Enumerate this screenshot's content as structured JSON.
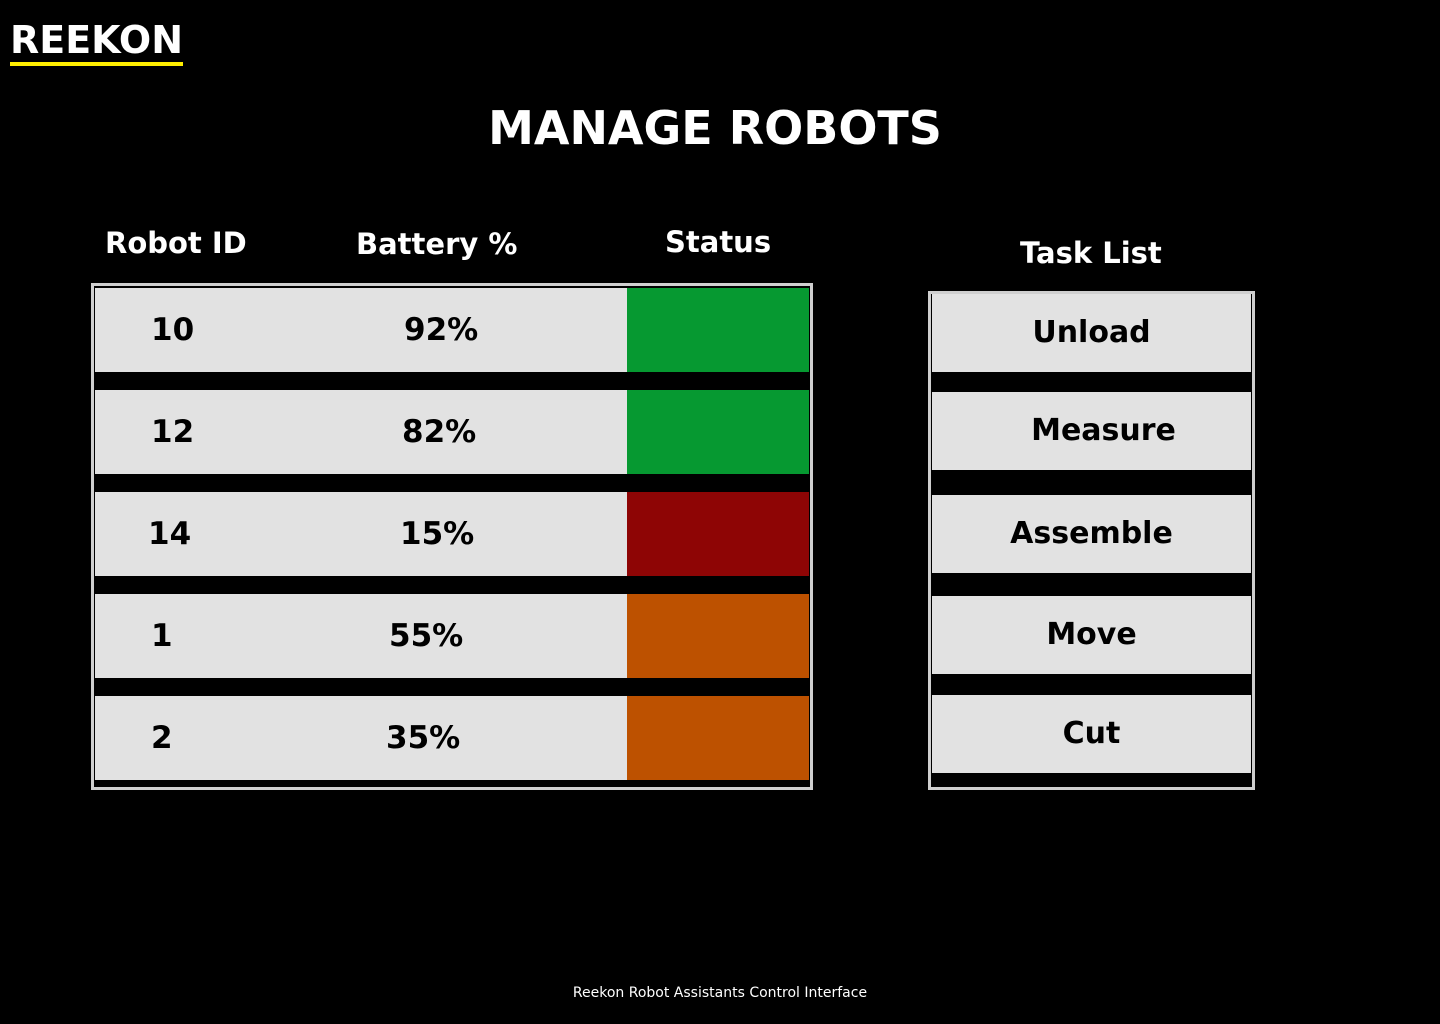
{
  "brand": {
    "logo_text": "REEKON",
    "accent_color": "#ffee00"
  },
  "page_title": "MANAGE ROBOTS",
  "robots": {
    "headers": {
      "id": "Robot ID",
      "battery": "Battery %",
      "status": "Status"
    },
    "rows": [
      {
        "id": "10",
        "battery": "92%",
        "status_color": "#069931"
      },
      {
        "id": "12",
        "battery": "82%",
        "status_color": "#069931"
      },
      {
        "id": "14",
        "battery": "15%",
        "status_color": "#8e0505"
      },
      {
        "id": "1",
        "battery": "55%",
        "status_color": "#bd5100"
      },
      {
        "id": "2",
        "battery": "35%",
        "status_color": "#bd5100"
      }
    ]
  },
  "tasks": {
    "header": "Task List",
    "items": [
      "Unload",
      "Measure",
      "Assemble",
      "Move",
      "Cut"
    ]
  },
  "footer_text": "Reekon Robot Assistants Control Interface"
}
